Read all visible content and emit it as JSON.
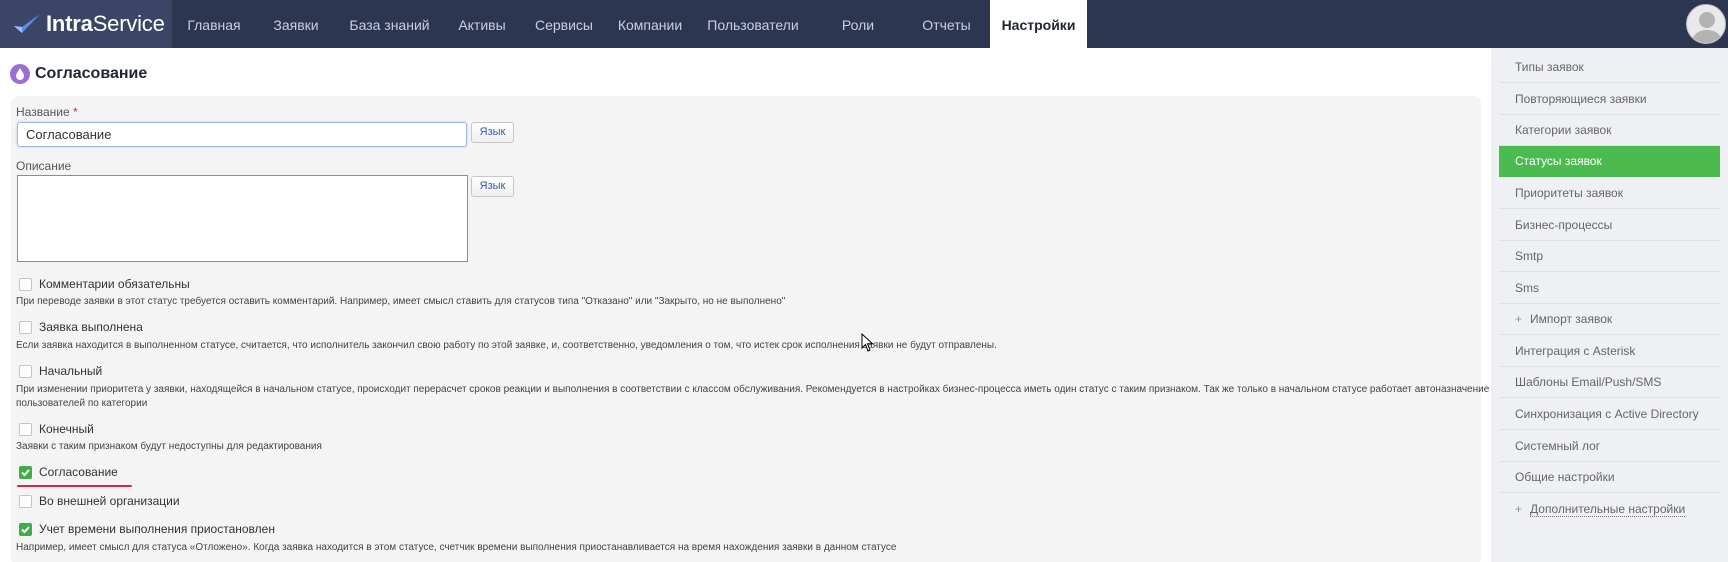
{
  "app": {
    "logo_part1": "Intra",
    "logo_part2": "Service"
  },
  "nav": [
    {
      "label": "Главная",
      "active": false
    },
    {
      "label": "Заявки",
      "active": false
    },
    {
      "label": "База знаний",
      "active": false
    },
    {
      "label": "Активы",
      "active": false
    },
    {
      "label": "Сервисы",
      "active": false
    },
    {
      "label": "Компании",
      "active": false
    },
    {
      "label": "Пользователи",
      "active": false
    },
    {
      "label": "Роли",
      "active": false
    },
    {
      "label": "Отчеты",
      "active": false
    },
    {
      "label": "Настройки",
      "active": true
    }
  ],
  "page": {
    "title": "Согласование"
  },
  "form": {
    "name_label": "Название",
    "name_required_mark": "*",
    "name_value": "Согласование",
    "lang_button": "Язык",
    "description_label": "Описание",
    "description_value": "",
    "options": [
      {
        "label": "Комментарии обязательны",
        "checked": false,
        "hint": "При переводе заявки в этот статус требуется оставить комментарий. Например, имеет смысл ставить для статусов типа \"Отказано\" или \"Закрыто, но не выполнено\""
      },
      {
        "label": "Заявка выполнена",
        "checked": false,
        "hint": "Если заявка находится в выполненном статусе, считается, что исполнитель закончил свою работу по этой заявке, и, соответственно, уведомления о том, что истек срок исполнения заявки не будут отправлены."
      },
      {
        "label": "Начальный",
        "checked": false,
        "hint_line1": "При изменении приоритета у заявки, находящейся в начальном статусе, происходит перерасчет сроков реакции и выполнения в соответствии с классом обслуживания. Рекомендуется в настройках бизнес-процесса иметь один статус с таким признаком. Так же только в начальном статусе работает автоназначение",
        "hint_line2": "пользователей по категории"
      },
      {
        "label": "Конечный",
        "checked": false,
        "hint": "Заявки с таким признаком будут недоступны для редактирования"
      },
      {
        "label": "Согласование",
        "checked": true
      },
      {
        "label": "Во внешней организации",
        "checked": false
      },
      {
        "label": "Учет времени выполнения приостановлен",
        "checked": true,
        "hint": "Например, имеет смысл для статуса «Отложено». Когда заявка находится в этом статусе, счетчик времени выполнения приостанавливается на время нахождения заявки в данном статусе"
      }
    ]
  },
  "sidebar": {
    "items": [
      {
        "label": "Типы заявок",
        "active": false
      },
      {
        "label": "Повторяющиеся заявки",
        "active": false
      },
      {
        "label": "Категории заявок",
        "active": false
      },
      {
        "label": "Статусы заявок",
        "active": true
      },
      {
        "label": "Приоритеты заявок",
        "active": false
      },
      {
        "label": "Бизнес-процессы",
        "active": false
      },
      {
        "label": "Smtp",
        "active": false
      },
      {
        "label": "Sms",
        "active": false
      },
      {
        "label": "Импорт заявок",
        "active": false,
        "plus": "+"
      },
      {
        "label": "Интеграция с Asterisk",
        "active": false
      },
      {
        "label": "Шаблоны Email/Push/SMS",
        "active": false
      },
      {
        "label": "Синхронизация с Active Directory",
        "active": false
      },
      {
        "label": "Системный лог",
        "active": false
      },
      {
        "label": "Общие настройки",
        "active": false
      },
      {
        "label": "Дополнительные настройки",
        "active": false,
        "plus": "+"
      }
    ]
  },
  "colors": {
    "topbar": "#2d3651",
    "accent_green": "#4cbb4f",
    "checked_green": "#3fae49",
    "required_red": "#d9283d"
  }
}
